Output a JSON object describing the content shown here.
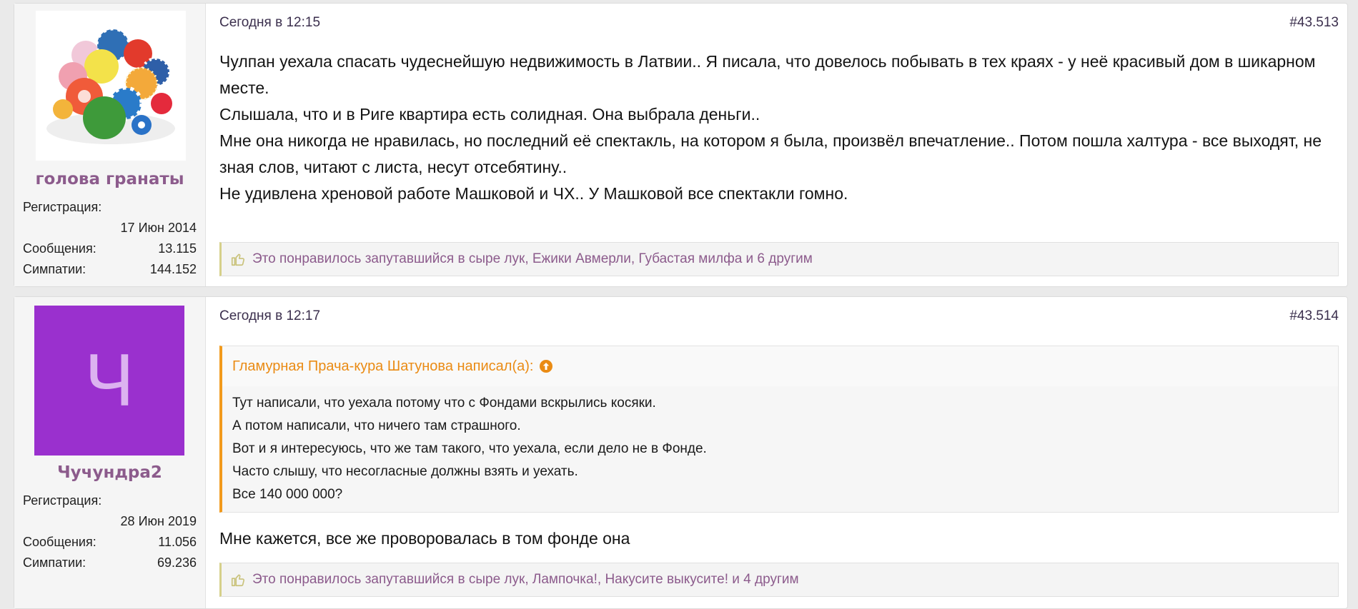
{
  "posts": [
    {
      "avatar": {
        "type": "photo",
        "alt": "colorful balls"
      },
      "username": "голова гранаты",
      "stats": {
        "registration_label": "Регистрация:",
        "registration_value": "17 Июн 2014",
        "messages_label": "Сообщения:",
        "messages_value": "13.115",
        "likes_label": "Симпатии:",
        "likes_value": "144.152"
      },
      "date": "Сегодня в 12:15",
      "number": "#43.513",
      "body": [
        "Чулпан уехала спасать чудеснейшую недвижимость в Латвии.. Я писала, что довелось побывать в тех краях - у неё красивый дом в шикарном месте.",
        "Слышала, что и в Риге квартира есть солидная. Она выбрала деньги..",
        "Мне она никогда не нравилась, но последний её спектакль, на котором я была, произвёл впечатление.. Потом пошла халтура - все выходят, не зная слов, читают с листа, несут отсебятину..",
        "Не удивлена хреновой работе Машковой и ЧХ.. У Машковой все спектакли гомно."
      ],
      "likes_text": "Это понравилось запутавшийся в сыре лук, Ежики Авмерли, Губастая милфа и 6 другим"
    },
    {
      "avatar": {
        "type": "letter",
        "letter": "Ч",
        "bg": "#9a30ce",
        "fg": "#dcb2f0"
      },
      "username": "Чучундра2",
      "stats": {
        "registration_label": "Регистрация:",
        "registration_value": "28 Июн 2019",
        "messages_label": "Сообщения:",
        "messages_value": "11.056",
        "likes_label": "Симпатии:",
        "likes_value": "69.236"
      },
      "date": "Сегодня в 12:17",
      "number": "#43.514",
      "quote": {
        "author": "Гламурная Прача-кура Шатунова написал(а):",
        "lines": [
          "Тут написали, что уехала потому что с Фондами вскрылись косяки.",
          "А потом написали, что ничего там страшного.",
          "Вот и я интересуюсь, что же там такого, что уехала, если дело не в Фонде.",
          "Часто слышу, что несогласные должны взять и уехать.",
          "Все 140 000 000?"
        ]
      },
      "body": [
        "Мне кажется, все же проворовалась в том фонде она"
      ],
      "likes_text": "Это понравилось запутавшийся в сыре лук, Лампочка!, Накусите выкусите! и 4 другим"
    }
  ],
  "colors": {
    "username": "#8c5b8c",
    "quote_accent": "#f29a1c",
    "likes_accent": "#d6d08a",
    "likes_text": "#8c5b8c"
  }
}
